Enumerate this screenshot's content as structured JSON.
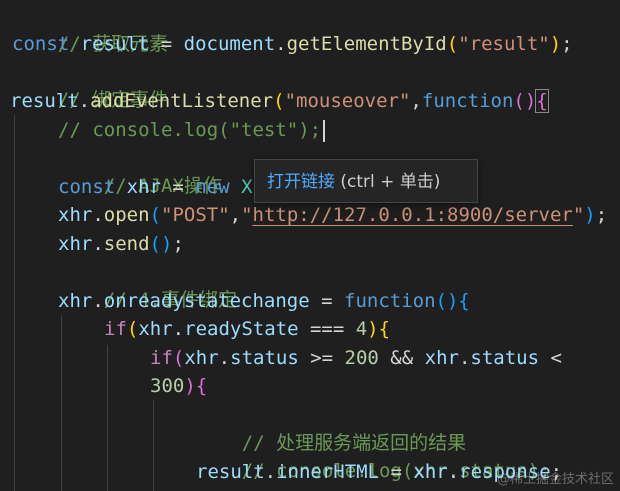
{
  "code": {
    "l1_comment": "// 获取元素",
    "l2_const": "const",
    "l2_result": "result",
    "l2_eq": " = ",
    "l2_document": "document",
    "l2_dot": ".",
    "l2_fn": "getElementById",
    "l2_open": "(",
    "l2_str": "\"result\"",
    "l2_close": ")",
    "l2_semi": ";",
    "l3_comment": "// 绑定事件",
    "l4_result": "result",
    "l4_dot": ".",
    "l4_fn": "addEventListener",
    "l4_open": "(",
    "l4_str": "\"mouseover\"",
    "l4_comma": ",",
    "l4_function": "function",
    "l4_params": "()",
    "l4_brace": "{",
    "l5_comment": "// console.log(\"test\");",
    "l6_comment": "// AJAX操作",
    "l7_const": "const",
    "l7_xhr": "xhr",
    "l7_eq": " = ",
    "l7_new": "new",
    "l7_x": "X",
    "l8_xhr": "xhr",
    "l8_dot": ".",
    "l8_fn": "open",
    "l8_open": "(",
    "l8_str1": "\"POST\"",
    "l8_comma": ",",
    "l8_q1": "\"",
    "l8_url": "http://127.0.0.1:8900/server",
    "l8_q2": "\"",
    "l8_close": ")",
    "l8_semi": ";",
    "l9_xhr": "xhr",
    "l9_dot": ".",
    "l9_fn": "send",
    "l9_parens": "()",
    "l9_semi": ";",
    "l10_comment": "// 4.事件绑定",
    "l11_xhr": "xhr",
    "l11_dot": ".",
    "l11_prop": "onreadystatechange",
    "l11_eq": " = ",
    "l11_function": "function",
    "l11_parens": "()",
    "l11_brace": "{",
    "l12_if": "if",
    "l12_open": "(",
    "l12_xhr": "xhr",
    "l12_dot": ".",
    "l12_prop": "readyState",
    "l12_op": " === ",
    "l12_num": "4",
    "l12_close": ")",
    "l12_brace": "{",
    "l13_if": "if",
    "l13_open": "(",
    "l13_xhr1": "xhr",
    "l13_dot1": ".",
    "l13_prop1": "status",
    "l13_op1": " >= ",
    "l13_num1": "200",
    "l13_and": " && ",
    "l13_xhr2": "xhr",
    "l13_dot2": ".",
    "l13_prop2": "status",
    "l13_op2": " <",
    "l14_num": "300",
    "l14_close": ")",
    "l14_brace": "{",
    "l15_comment": "// 处理服务端返回的结果",
    "l16_comment": "// console.log(xhr.status);",
    "l17_result": "result",
    "l17_dot": ".",
    "l17_prop": "innerHTML",
    "l17_eq": " = ",
    "l17_xhr": "xhr",
    "l17_dot2": ".",
    "l17_prop2": "response",
    "l17_semi": ";"
  },
  "tooltip": {
    "link_text": "打开链接",
    "hint": " (ctrl + 单击)"
  },
  "watermark": "@稀土掘金技术社区"
}
